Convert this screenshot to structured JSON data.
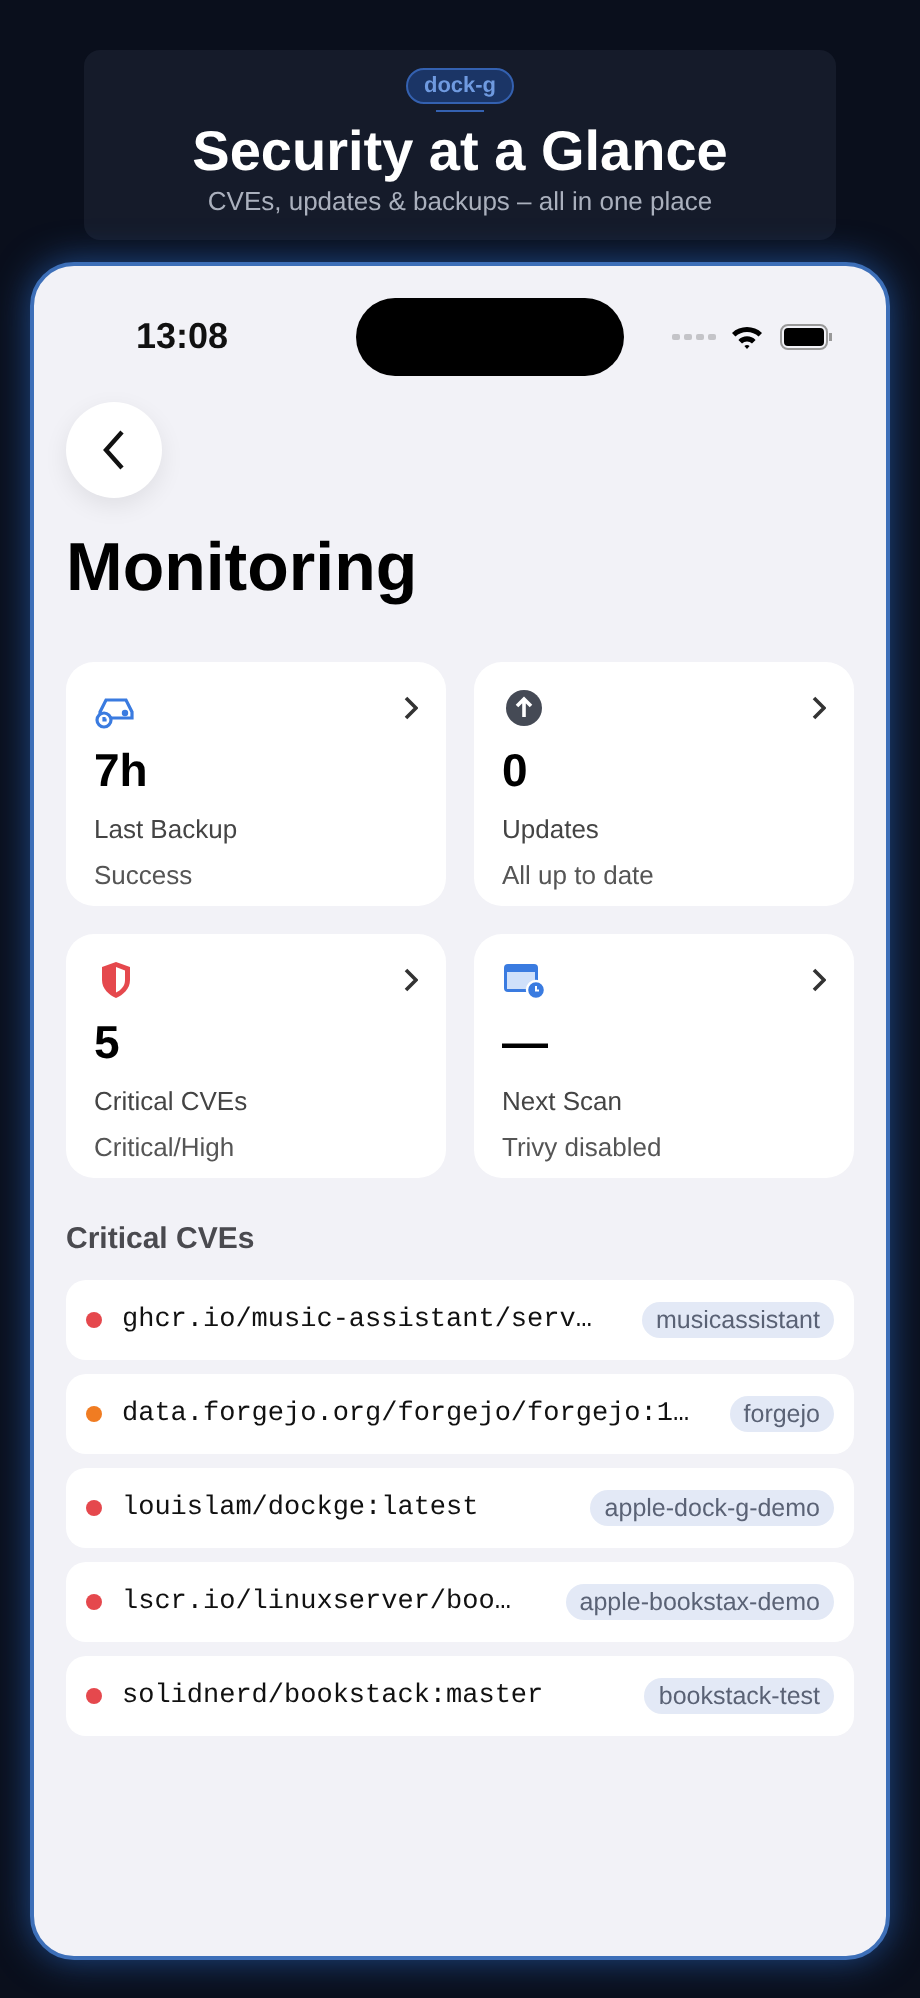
{
  "banner": {
    "badge": "dock-g",
    "title": "Security at a Glance",
    "subtitle": "CVEs, updates & backups – all in one place"
  },
  "status_bar": {
    "time": "13:08"
  },
  "page": {
    "title": "Monitoring"
  },
  "cards": [
    {
      "kind": "backup",
      "value": "7h",
      "label": "Last Backup",
      "detail": "Success"
    },
    {
      "kind": "updates",
      "value": "0",
      "label": "Updates",
      "detail": "All up to date"
    },
    {
      "kind": "shield",
      "value": "5",
      "label": "Critical CVEs",
      "detail": "Critical/High"
    },
    {
      "kind": "calendar",
      "value": "—",
      "label": "Next Scan",
      "detail": "Trivy disabled"
    }
  ],
  "section": {
    "title": "Critical CVEs"
  },
  "cves": [
    {
      "image": "ghcr.io/music-assistant/serv…",
      "stack": "musicassistant",
      "color": "#e5484d"
    },
    {
      "image": "data.forgejo.org/forgejo/forgejo:1…",
      "stack": "forgejo",
      "color": "#f07c22"
    },
    {
      "image": "louislam/dockge:latest",
      "stack": "apple-dock-g-demo",
      "color": "#e5484d"
    },
    {
      "image": "lscr.io/linuxserver/boo…",
      "stack": "apple-bookstax-demo",
      "color": "#e5484d"
    },
    {
      "image": "solidnerd/bookstack:master",
      "stack": "bookstack-test",
      "color": "#e5484d"
    }
  ]
}
